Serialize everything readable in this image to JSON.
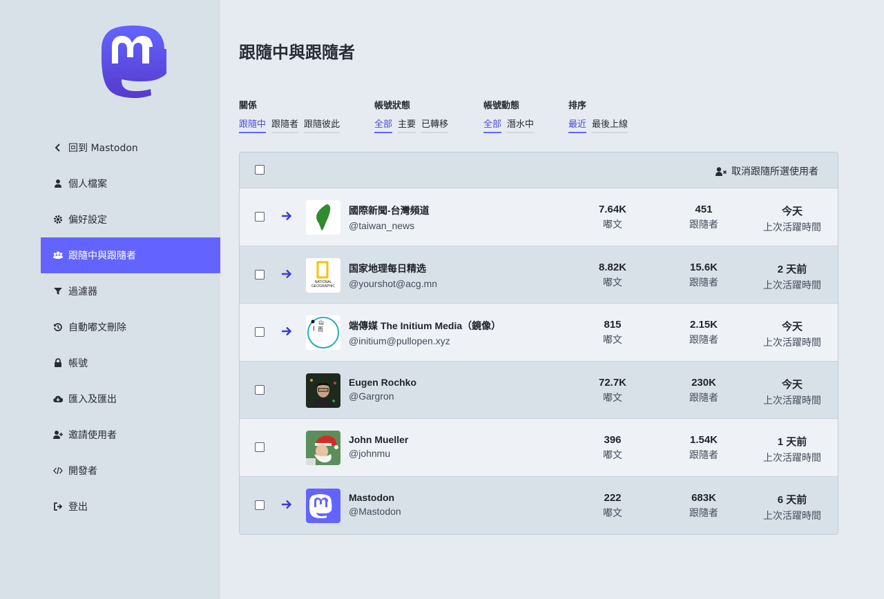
{
  "page_title": "跟隨中與跟隨者",
  "nav": [
    {
      "label": "回到 Mastodon",
      "icon": "chevron-left-icon",
      "active": false
    },
    {
      "label": "個人檔案",
      "icon": "user-icon",
      "active": false
    },
    {
      "label": "偏好設定",
      "icon": "gear-icon",
      "active": false
    },
    {
      "label": "跟隨中與跟隨者",
      "icon": "users-icon",
      "active": true
    },
    {
      "label": "過濾器",
      "icon": "filter-icon",
      "active": false
    },
    {
      "label": "自動嘟文刪除",
      "icon": "history-icon",
      "active": false
    },
    {
      "label": "帳號",
      "icon": "lock-icon",
      "active": false
    },
    {
      "label": "匯入及匯出",
      "icon": "cloud-download-icon",
      "active": false
    },
    {
      "label": "邀請使用者",
      "icon": "user-plus-icon",
      "active": false
    },
    {
      "label": "開發者",
      "icon": "code-icon",
      "active": false
    },
    {
      "label": "登出",
      "icon": "sign-out-icon",
      "active": false
    }
  ],
  "filters": [
    {
      "label": "關係",
      "options": [
        "跟隨中",
        "跟隨者",
        "跟隨彼此"
      ],
      "selected": 0
    },
    {
      "label": "帳號狀態",
      "options": [
        "全部",
        "主要",
        "已轉移"
      ],
      "selected": 0
    },
    {
      "label": "帳號動態",
      "options": [
        "全部",
        "潛水中"
      ],
      "selected": 0
    },
    {
      "label": "排序",
      "options": [
        "最近",
        "最後上線"
      ],
      "selected": 0
    }
  ],
  "table": {
    "unfollow_label": "取消跟隨所選使用者",
    "rows": [
      {
        "display_name": "國際新聞-台灣頻道",
        "username": "@taiwan_news",
        "posts": "7.64K",
        "posts_label": "嘟文",
        "followers": "451",
        "followers_label": "跟隨者",
        "last_active": "今天",
        "last_active_label": "上次活躍時間",
        "mutual": true,
        "avatar": "taiwan"
      },
      {
        "display_name": "国家地理每日精选",
        "username": "@yourshot@acg.mn",
        "posts": "8.82K",
        "posts_label": "嘟文",
        "followers": "15.6K",
        "followers_label": "跟隨者",
        "last_active": "2 天前",
        "last_active_label": "上次活躍時間",
        "mutual": true,
        "avatar": "natgeo",
        "avatar_text": [
          "NATIONAL",
          "GEOGRAPHIC"
        ]
      },
      {
        "display_name": "端傳媒 The Initium Media（鏡像）",
        "username": "@initium@pullopen.xyz",
        "posts": "815",
        "posts_label": "嘟文",
        "followers": "2.15K",
        "followers_label": "跟隨者",
        "last_active": "今天",
        "last_active_label": "上次活躍時間",
        "mutual": true,
        "avatar": "initium",
        "avatar_text": [
          "I",
          "山",
          "而"
        ]
      },
      {
        "display_name": "Eugen Rochko",
        "username": "@Gargron",
        "posts": "72.7K",
        "posts_label": "嘟文",
        "followers": "230K",
        "followers_label": "跟隨者",
        "last_active": "今天",
        "last_active_label": "上次活躍時間",
        "mutual": false,
        "avatar": "photo-dark"
      },
      {
        "display_name": "John Mueller",
        "username": "@johnmu",
        "posts": "396",
        "posts_label": "嘟文",
        "followers": "1.54K",
        "followers_label": "跟隨者",
        "last_active": "1 天前",
        "last_active_label": "上次活躍時間",
        "mutual": false,
        "avatar": "photo-santa"
      },
      {
        "display_name": "Mastodon",
        "username": "@Mastodon",
        "posts": "222",
        "posts_label": "嘟文",
        "followers": "683K",
        "followers_label": "跟隨者",
        "last_active": "6 天前",
        "last_active_label": "上次活躍時間",
        "mutual": true,
        "avatar": "mastodon"
      }
    ]
  },
  "colors": {
    "accent": "#6364ff",
    "arrow": "#3a3bd6",
    "sidebar_bg": "#d9e1e8",
    "page_bg": "#e6ebf1"
  }
}
